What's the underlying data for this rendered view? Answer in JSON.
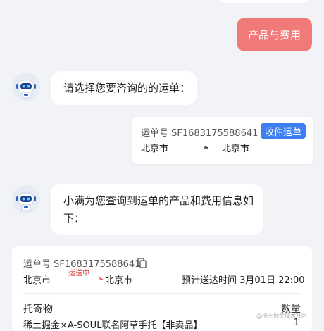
{
  "user_message": {
    "text": "产品与费用"
  },
  "bot_message_1": {
    "text": "请选择您要咨询的的运单："
  },
  "waybill_card": {
    "number_label": "运单号 SF1683175588641",
    "action_label": "收件运单",
    "from_city": "北京市",
    "to_city": "北京市"
  },
  "bot_message_2": {
    "line1": "小满为您查询到运单的产品和费用信息如",
    "line2": "下："
  },
  "info_card": {
    "number_label": "运单号 SF1683175588641",
    "from_city": "北京市",
    "status": "运送中",
    "to_city": "北京市",
    "eta": "预计送达时间 3月01日 22:00",
    "col_item": "托寄物",
    "col_qty": "数量",
    "item_name": "稀土掘金×A-SOUL联名阿草手托【非卖品】",
    "item_qty": "1"
  },
  "watermark": "@稀土掘金技术社区",
  "colors": {
    "user_bubble": "#f07a78",
    "button_blue": "#3d7ff2",
    "status_red": "#e04a46"
  }
}
